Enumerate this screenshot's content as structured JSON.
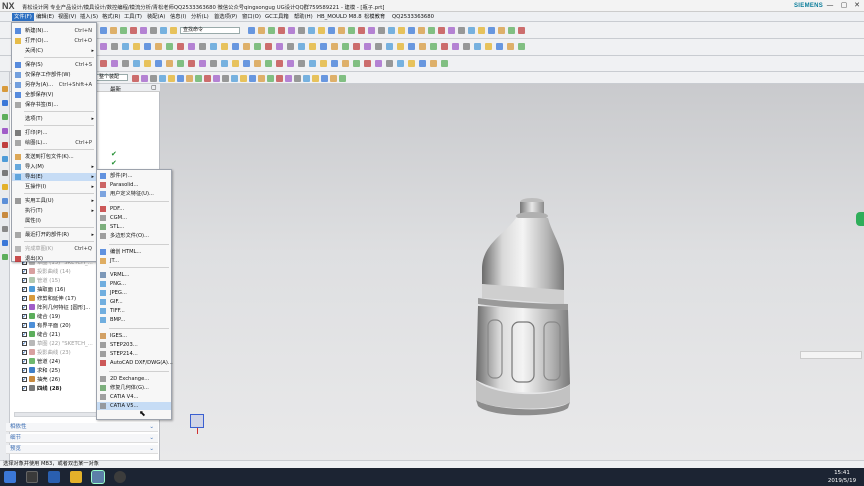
{
  "window": {
    "logo": "NX",
    "title": "青松设计网 专业产品设计/模具设计/数控编程/模流分析/青松老师QQ2533363680 微信公众号qingsongug UG设计QQ群759589221 - 建模 - [瓶子.prt]",
    "brand": "SIEMENS",
    "min": "—",
    "max": "▢",
    "close": "✕"
  },
  "menubar": {
    "items": [
      "文件(F)",
      "编辑(E)",
      "视图(V)",
      "插入(S)",
      "格式(R)",
      "工具(T)",
      "装配(A)",
      "信息(I)",
      "分析(L)",
      "首选项(P)",
      "窗口(O)",
      "GC工具箱",
      "帮助(H)",
      "HB_MOULD M8.8",
      "松模教育",
      "QQ2533363680"
    ]
  },
  "toolbar": {
    "filter_value": "整个装配",
    "command_search": "查找命令"
  },
  "file_menu": {
    "items": [
      {
        "label": "新建(N)...",
        "shortcut": "Ctrl+N"
      },
      {
        "label": "打开(O)...",
        "shortcut": "Ctrl+O"
      },
      {
        "label": "关闭(C)",
        "arrow": "▸"
      },
      {
        "label": "保存(S)",
        "shortcut": "Ctrl+S"
      },
      {
        "label": "仅保存工作部件(W)"
      },
      {
        "label": "另存为(A)...",
        "shortcut": "Ctrl+Shift+A"
      },
      {
        "label": "全部保存(V)"
      },
      {
        "label": "保存书签(B)..."
      },
      {
        "label": "选项(T)",
        "arrow": "▸"
      },
      {
        "label": "打印(P)..."
      },
      {
        "label": "绘图(L)...",
        "shortcut": "Ctrl+P"
      },
      {
        "label": "发送到打包文件(K)..."
      },
      {
        "label": "导入(M)",
        "arrow": "▸"
      },
      {
        "label": "导出(E)",
        "arrow": "▸"
      },
      {
        "label": "互操作(I)",
        "arrow": "▸"
      },
      {
        "label": "实用工具(U)",
        "arrow": "▸"
      },
      {
        "label": "执行(T)",
        "arrow": "▸"
      },
      {
        "label": "属性(I)"
      },
      {
        "label": "最近打开的部件(R)",
        "arrow": "▸"
      },
      {
        "label": "完成草图(K)",
        "shortcut": "Ctrl+Q"
      },
      {
        "label": "退出(X)"
      }
    ]
  },
  "export_menu": {
    "items": [
      "部件(P)...",
      "Parasolid...",
      "用户定义特征(U)...",
      "PDF...",
      "CGM...",
      "STL...",
      "多边形文件(O)...",
      "编创 HTML...",
      "JT...",
      "VRML...",
      "PNG...",
      "JPEG...",
      "GIF...",
      "TIFF...",
      "BMP...",
      "IGES...",
      "STEP203...",
      "STEP214...",
      "AutoCAD DXF/DWG(A)...",
      "2D Exchange...",
      "修复几何体(G)...",
      "CATIA V4...",
      "CATIA V5..."
    ]
  },
  "navigator": {
    "column_latest": "最新",
    "rows": [
      {
        "label": "草图 (13) \"SKETCH_...",
        "dim": true
      },
      {
        "label": "投影曲线 (14)",
        "dim": true
      },
      {
        "label": "管道 (15)",
        "dim": true
      },
      {
        "label": "抽取面 (16)",
        "dim": false
      },
      {
        "label": "修剪和延伸 (17)",
        "dim": false
      },
      {
        "label": "阵列几何特征 [圆形]...",
        "dim": false
      },
      {
        "label": "缝合 (19)",
        "dim": false
      },
      {
        "label": "有界平面 (20)",
        "dim": false
      },
      {
        "label": "缝合 (21)",
        "dim": false
      },
      {
        "label": "草图 (22) \"SKETCH_...",
        "dim": true
      },
      {
        "label": "投影曲线 (23)",
        "dim": true
      },
      {
        "label": "管道 (24)",
        "dim": false
      },
      {
        "label": "求和 (25)",
        "dim": false
      },
      {
        "label": "抽壳 (26)",
        "dim": false
      },
      {
        "label": "四线 (28)",
        "dim": false
      }
    ],
    "sections": [
      "相依性",
      "细节",
      "预览"
    ]
  },
  "status": {
    "text": "选择对象并使用 MB3，或者双击某一对象"
  },
  "taskbar": {
    "time": "15:41",
    "date": "2019/5/19"
  }
}
